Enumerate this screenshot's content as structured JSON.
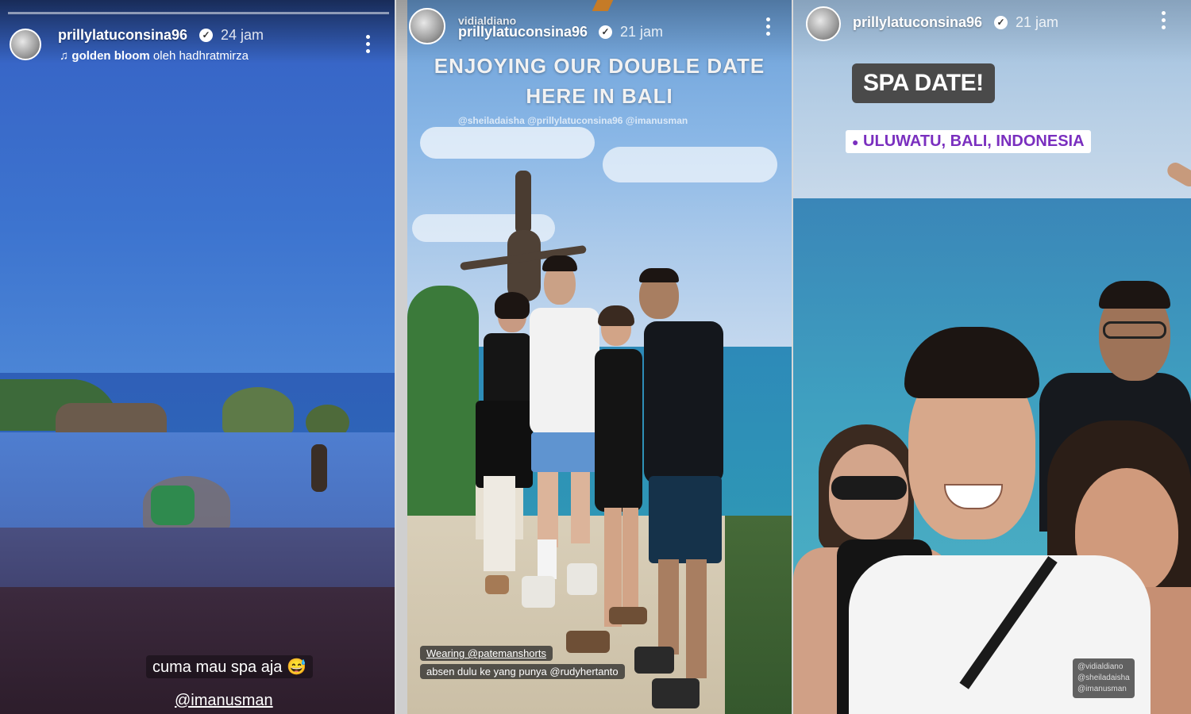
{
  "stories": [
    {
      "username": "prillylatuconsina96",
      "time": "24 jam",
      "music_title": "golden bloom",
      "music_by": "oleh hadhratmirza",
      "caption": "cuma mau spa aja 😅",
      "mention": "@imanusman",
      "verified_icon": "verified-check-icon",
      "menu_icon": "more-vertical-icon"
    },
    {
      "overlay_user": "vidialdiano",
      "username": "prillylatuconsina96",
      "time": "21 jam",
      "title_line1": "ENJOYING OUR DOUBLE DATE",
      "title_line2": "HERE IN BALI",
      "mentions": "@sheiladaisha @prillylatuconsina96 @imanusman",
      "wearing_line": "Wearing @patemanshorts",
      "absen_line": "absen dulu ke yang punya @rudyhertanto"
    },
    {
      "username": "prillylatuconsina96",
      "time": "21 jam",
      "sticker": "SPA DATE!",
      "location": "ULUWATU, BALI, INDONESIA",
      "tags": [
        "@vidialdiano",
        "@sheiladaisha",
        "@imanusman"
      ]
    }
  ],
  "colors": {
    "sky": "#3c6fc9",
    "ocean": "#2f86b5",
    "location_text": "#7a2fbf",
    "sticker_bg": "#4a4a4a"
  }
}
